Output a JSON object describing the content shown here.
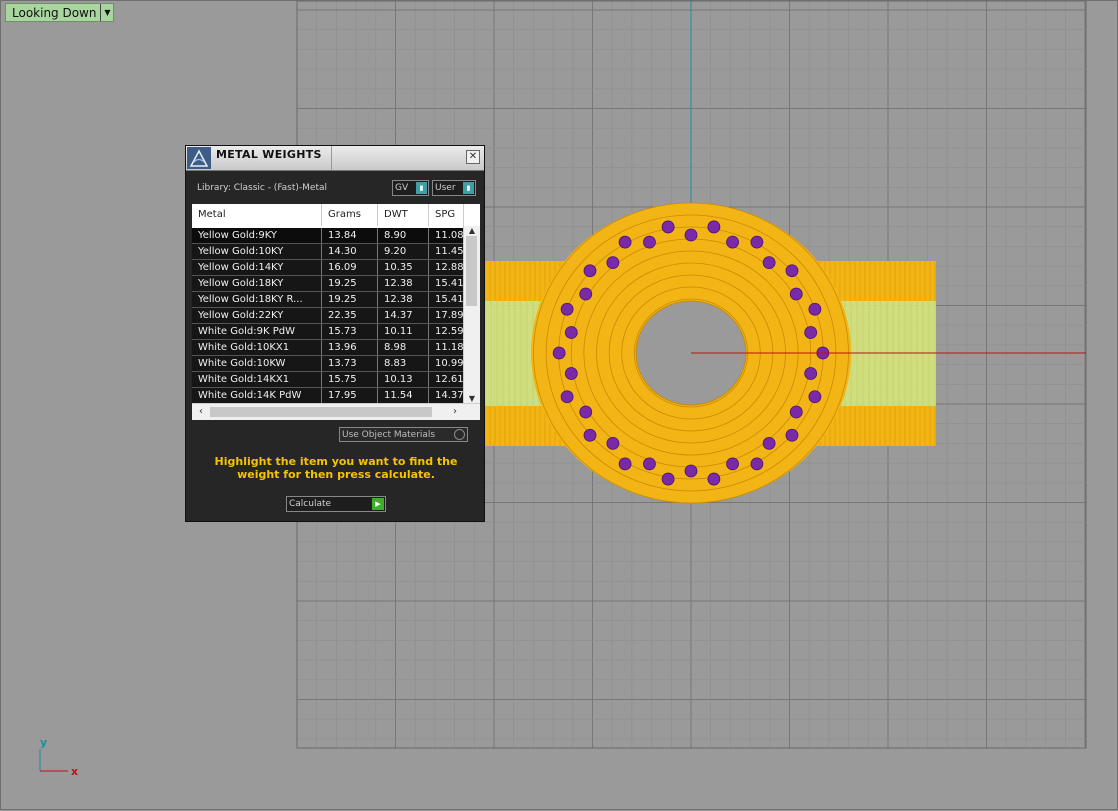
{
  "viewport": {
    "view_label": "Looking Down",
    "axis_y": "y",
    "axis_x": "x",
    "colors": {
      "background": "#9a9a9a",
      "grid": "#878787",
      "metal": "#f2b515",
      "shank": "#d9ea7a",
      "gems": "#7a2aa8",
      "axis_x": "#c01010",
      "axis_y": "#1a8fa3"
    }
  },
  "panel": {
    "title": "METAL WEIGHTS",
    "library": "Library: Classic - (Fast)-Metal",
    "gv_select": "GV",
    "user_select": "User",
    "columns": [
      "Metal",
      "Grams",
      "DWT",
      "SPG"
    ],
    "rows": [
      {
        "metal": "Yellow Gold:9KY",
        "grams": "13.84",
        "dwt": "8.90",
        "spg": "11.08"
      },
      {
        "metal": "Yellow Gold:10KY",
        "grams": "14.30",
        "dwt": "9.20",
        "spg": "11.45"
      },
      {
        "metal": "Yellow Gold:14KY",
        "grams": "16.09",
        "dwt": "10.35",
        "spg": "12.88"
      },
      {
        "metal": "Yellow Gold:18KY",
        "grams": "19.25",
        "dwt": "12.38",
        "spg": "15.41"
      },
      {
        "metal": "Yellow Gold:18KY R...",
        "grams": "19.25",
        "dwt": "12.38",
        "spg": "15.41"
      },
      {
        "metal": "Yellow Gold:22KY",
        "grams": "22.35",
        "dwt": "14.37",
        "spg": "17.89"
      },
      {
        "metal": "White Gold:9K PdW",
        "grams": "15.73",
        "dwt": "10.11",
        "spg": "12.59"
      },
      {
        "metal": "White Gold:10KX1",
        "grams": "13.96",
        "dwt": "8.98",
        "spg": "11.18"
      },
      {
        "metal": "White Gold:10KW",
        "grams": "13.73",
        "dwt": "8.83",
        "spg": "10.99"
      },
      {
        "metal": "White Gold:14KX1",
        "grams": "15.75",
        "dwt": "10.13",
        "spg": "12.61"
      },
      {
        "metal": "White Gold:14K PdW",
        "grams": "17.95",
        "dwt": "11.54",
        "spg": "14.37"
      }
    ],
    "use_object_materials": "Use Object Materials",
    "hint": "Highlight the item you want to find the weight for then press calculate.",
    "calculate": "Calculate"
  }
}
